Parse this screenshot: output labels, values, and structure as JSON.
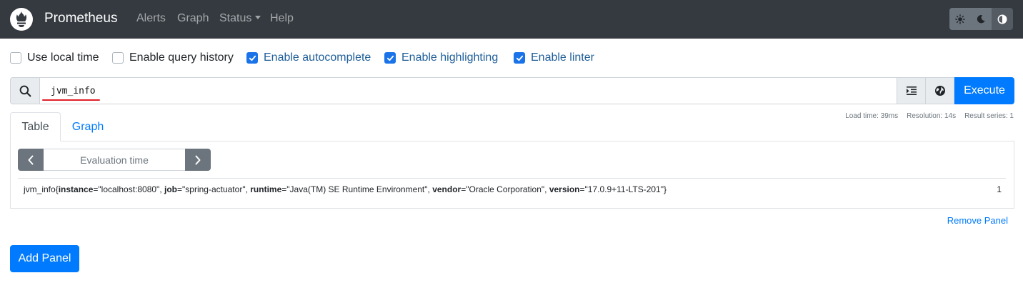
{
  "navbar": {
    "brand": "Prometheus",
    "links": {
      "alerts": "Alerts",
      "graph": "Graph",
      "status": "Status",
      "help": "Help"
    },
    "theme_buttons": [
      "light-theme",
      "dark-theme",
      "browser-theme"
    ],
    "background_color": "#343a40"
  },
  "options": {
    "use_local_time": {
      "label": "Use local time",
      "checked": false
    },
    "enable_query_history": {
      "label": "Enable query history",
      "checked": false
    },
    "enable_autocomplete": {
      "label": "Enable autocomplete",
      "checked": true
    },
    "enable_highlighting": {
      "label": "Enable highlighting",
      "checked": true
    },
    "enable_linter": {
      "label": "Enable linter",
      "checked": true
    }
  },
  "query": {
    "expression": "jvm_info",
    "execute_label": "Execute",
    "accent_color": "#007bff"
  },
  "stats": {
    "load_time": "Load time: 39ms",
    "resolution": "Resolution: 14s",
    "result_series": "Result series: 1"
  },
  "tabs": {
    "table": "Table",
    "graph": "Graph",
    "active": "Table"
  },
  "evaluation": {
    "placeholder": "Evaluation time"
  },
  "result": {
    "metric": "jvm_info",
    "labels": [
      {
        "name": "instance",
        "value": "\"localhost:8080\""
      },
      {
        "name": "job",
        "value": "\"spring-actuator\""
      },
      {
        "name": "runtime",
        "value": "\"Java(TM) SE Runtime Environment\""
      },
      {
        "name": "vendor",
        "value": "\"Oracle Corporation\""
      },
      {
        "name": "version",
        "value": "\"17.0.9+11-LTS-201\""
      }
    ],
    "value": "1"
  },
  "actions": {
    "remove_panel": "Remove Panel",
    "add_panel": "Add Panel"
  }
}
